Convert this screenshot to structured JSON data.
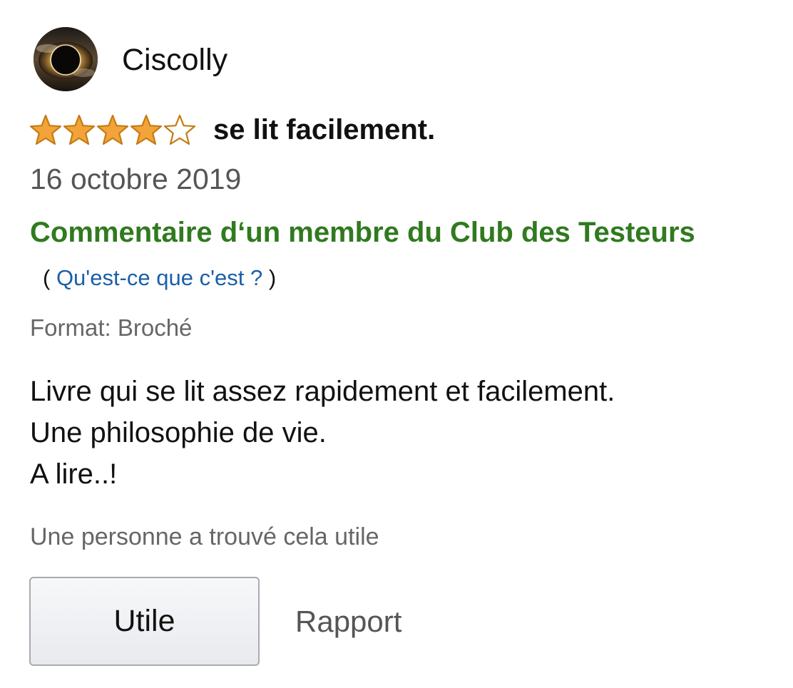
{
  "review": {
    "author": "Ciscolly",
    "rating": 4,
    "rating_max": 5,
    "title": "se lit facilement.",
    "date": "16 octobre 2019",
    "vine_label": "Commentaire d‘un membre du Club des Testeurs",
    "whats_this_open": "( ",
    "whats_this_link": "Qu'est-ce que c'est ?",
    "whats_this_close": " )",
    "format": "Format: Broché",
    "body_lines": [
      "Livre qui se lit assez rapidement et facilement.",
      "Une philosophie de vie.",
      "A lire..!"
    ],
    "helpful_text": "Une personne a trouvé cela utile"
  },
  "actions": {
    "useful_label": "Utile",
    "report_label": "Rapport"
  },
  "icons": {
    "avatar": "eclipse-avatar-icon",
    "star_filled": "star-filled-icon",
    "star_empty": "star-empty-icon"
  },
  "colors": {
    "vine_green": "#307a1f",
    "link_blue": "#1a5fa8",
    "star_gold": "#f2a33a",
    "star_outline": "#c57b12"
  }
}
